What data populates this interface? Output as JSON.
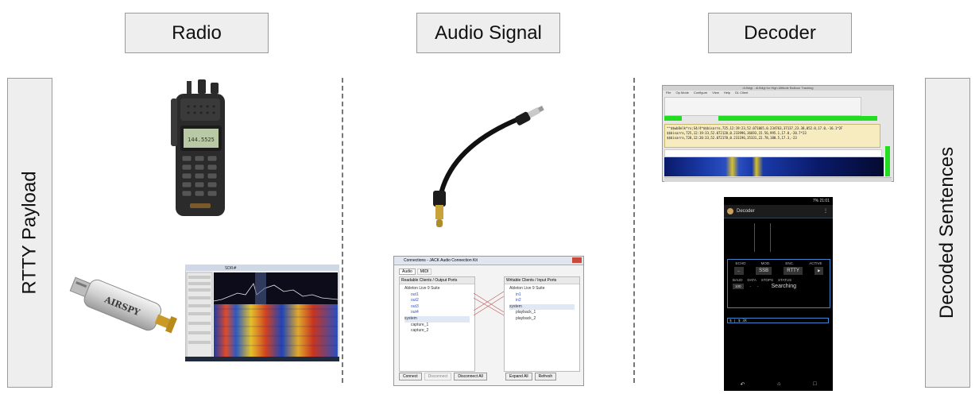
{
  "headers": {
    "radio": "Radio",
    "audio": "Audio Signal",
    "decoder": "Decoder"
  },
  "side": {
    "left": "RTTY Payload",
    "right": "Decoded Sentences"
  },
  "radio": {
    "display_text": "144.5525",
    "brand": "AIRSPY",
    "sdr_title": "SDR#"
  },
  "jack": {
    "title": "Connections - JACK Audio Connection Kit",
    "tabs": [
      "Audio",
      "MIDI"
    ],
    "left_header": "Readable Clients / Output Ports",
    "right_header": "Writable Clients / Input Ports",
    "left_items": [
      "Ableton Live 9 Suite",
      "out1",
      "out2",
      "out3",
      "out4",
      "system",
      "capture_1",
      "capture_2"
    ],
    "right_items": [
      "Ableton Live 9 Suite",
      "in1",
      "in2",
      "system",
      "playback_1",
      "playback_2"
    ],
    "buttons": [
      "Connect",
      "Disconnect",
      "Disconnect All",
      "Expand All",
      "Refresh"
    ]
  },
  "fldigi": {
    "title": "dl-fldigi - dl-fldigi for High Altitude Balloon Tracking",
    "menu": [
      "File",
      "Op Mode",
      "Configure",
      "View",
      "Help",
      "DL Client"
    ],
    "decoded_lines": [
      "^^$$wb8elk*rx;S4/4*$$bisarro,725,12:19:23,52.071065,0.234763,37137,23.38,052.0,17.0,-16.1*2F",
      "$$bisarro,725,12:19:33,52.072120,0.233996,36693,15.56,995.1,17.0,-20.7*23",
      "$$bisarro,728,12:20:33,52.072170,0.231196,35331,22.78,180.5,17.3,-23"
    ]
  },
  "phone": {
    "status_time": "21:01",
    "status_battery": "7%",
    "app_title": "Decoder",
    "labels": [
      "ECHO",
      "MOD.",
      "ENC.",
      "ACTIVE"
    ],
    "mode": "SSB",
    "encoding": "RTTY",
    "labels2": [
      "BAUD",
      "DATA",
      "STOPS",
      "STATUS"
    ],
    "baud": "100",
    "data_dash": "-",
    "stops_dash": "-",
    "status": "Searching",
    "log_line": "$ | $ 3X"
  },
  "colors": {
    "fldigi_text_bg": "#f7ecc0",
    "fldigi_green": "#22dd22",
    "phone_accent": "#3a86c8"
  }
}
